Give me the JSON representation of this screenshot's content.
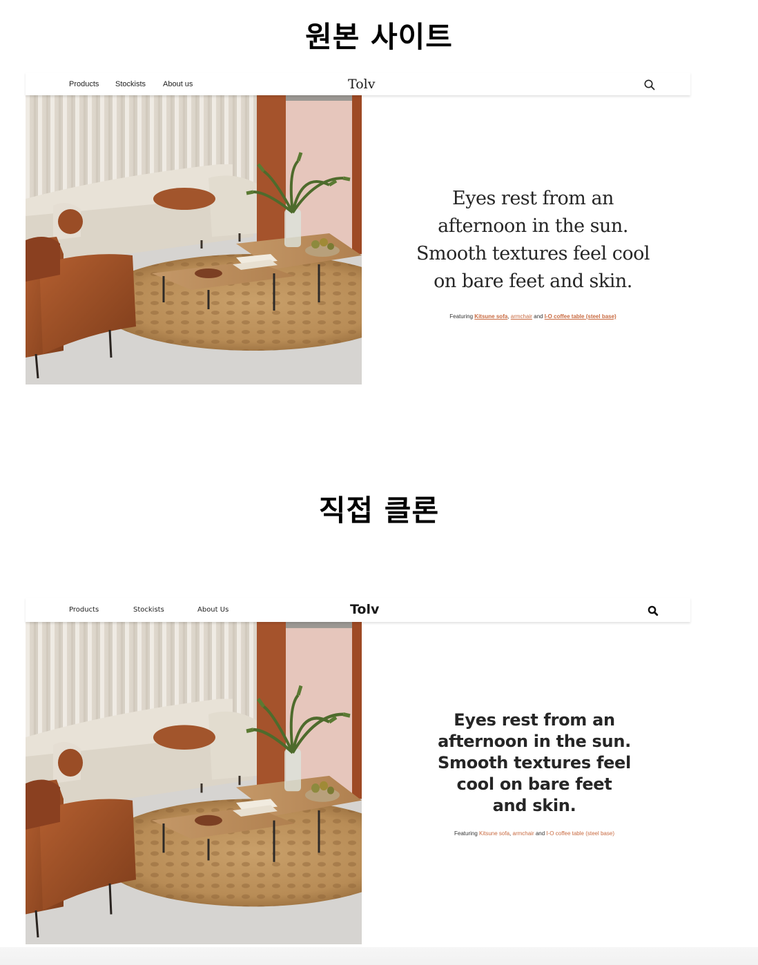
{
  "headings": {
    "original": "원본 사이트",
    "clone": "직접 클론"
  },
  "original_site": {
    "nav": {
      "products": "Products",
      "stockists": "Stockists",
      "about": "About us"
    },
    "logo": "Tolv",
    "headline": "Eyes rest from an afternoon in the sun. Smooth textures feel cool on bare feet and skin.",
    "caption": {
      "prefix": "Featuring ",
      "link1": "Kitsune sofa",
      "sep": ", ",
      "link2": "armchair",
      "and": " and ",
      "link3": "I-O coffee table (steel base)"
    }
  },
  "clone_site": {
    "nav": {
      "products": "Products",
      "stockists": "Stockists",
      "about": "About Us"
    },
    "logo": "Tolv",
    "headline": "Eyes rest from an afternoon in the sun. Smooth textures feel cool on bare feet and skin.",
    "caption": {
      "prefix": "Featuring ",
      "link1": "Kitsune sofa",
      "sep": ", ",
      "link2": "armchair",
      "and": " and ",
      "link3": "I-O coffee table (steel base)"
    }
  },
  "colors": {
    "accent": "#c8693f",
    "text": "#262626"
  },
  "icons": {
    "search": "search-icon"
  }
}
